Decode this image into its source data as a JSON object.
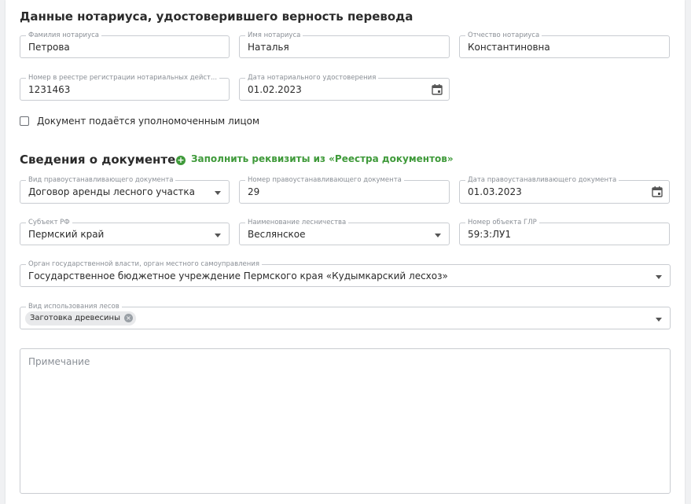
{
  "notary_section": {
    "title": "Данные нотариуса, удостоверившего верность перевода",
    "last_name": {
      "label": "Фамилия нотариуса",
      "value": "Петрова"
    },
    "first_name": {
      "label": "Имя нотариуса",
      "value": "Наталья"
    },
    "patronymic": {
      "label": "Отчество нотариуса",
      "value": "Константиновна"
    },
    "registry_number": {
      "label": "Номер в реестре регистрации нотариальных дейст...",
      "value": "1231463"
    },
    "certification_date": {
      "label": "Дата нотариального удостоверения",
      "value": "01.02.2023"
    },
    "authorized_person": {
      "label": "Документ подаётся уполномоченным лицом",
      "checked": false
    }
  },
  "document_section": {
    "title": "Сведения о документе",
    "fill_link": {
      "icon": "plus-circle-icon",
      "label": "Заполнить реквизиты из «Реестра документов»"
    },
    "doc_type": {
      "label": "Вид правоустанавливающего документа",
      "value": "Договор аренды лесного участка"
    },
    "doc_number": {
      "label": "Номер правоустанавливающего документа",
      "value": "29"
    },
    "doc_date": {
      "label": "Дата правоустанавливающего документа",
      "value": "01.03.2023"
    },
    "region": {
      "label": "Субъект РФ",
      "value": "Пермский край"
    },
    "forestry": {
      "label": "Наименование лесничества",
      "value": "Веслянское"
    },
    "glr_object": {
      "label": "Номер объекта ГЛР",
      "value": "59:3:ЛУ1"
    },
    "authority": {
      "label": "Орган государственной власти, орган местного самоуправления",
      "value": "Государственное бюджетное учреждение Пермского края «Кудымкарский лесхоз»"
    },
    "forest_use": {
      "label": "Вид использования лесов",
      "chips": [
        "Заготовка древесины"
      ]
    },
    "note": {
      "placeholder": "Примечание"
    }
  },
  "colors": {
    "accent": "#3f9a3a",
    "border": "#c9ccd1",
    "label": "#8a8f96"
  }
}
